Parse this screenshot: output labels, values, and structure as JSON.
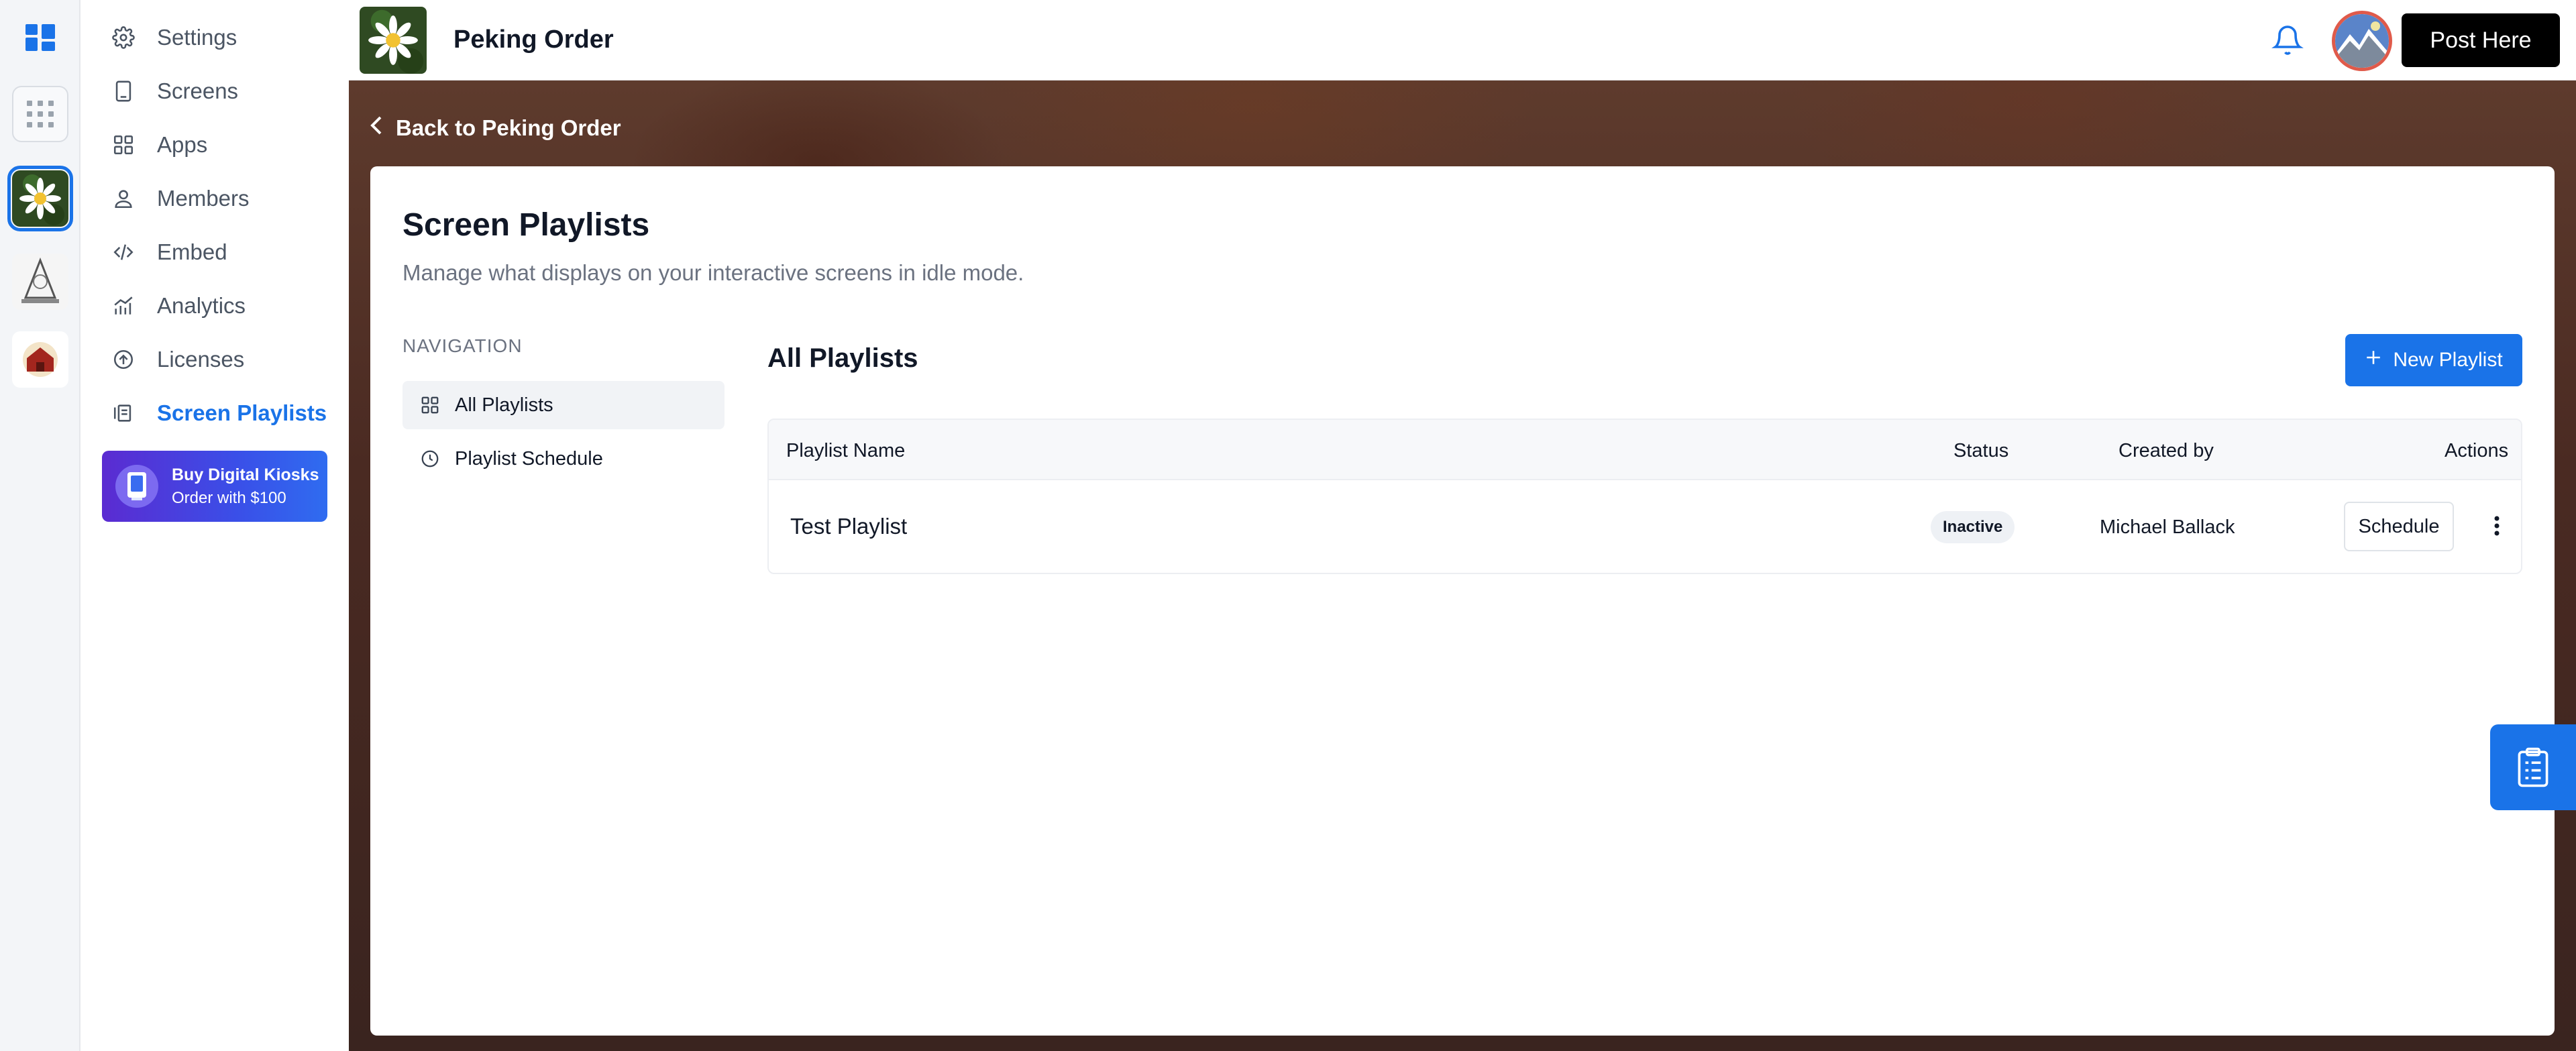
{
  "sidebar": {
    "items": [
      {
        "label": "Settings",
        "icon": "gear-icon"
      },
      {
        "label": "Screens",
        "icon": "tablet-icon"
      },
      {
        "label": "Apps",
        "icon": "grid-icon"
      },
      {
        "label": "Members",
        "icon": "user-icon"
      },
      {
        "label": "Embed",
        "icon": "code-icon"
      },
      {
        "label": "Analytics",
        "icon": "chart-icon"
      },
      {
        "label": "Licenses",
        "icon": "upload-circle-icon"
      },
      {
        "label": "Screen Playlists",
        "icon": "playlist-icon",
        "active": true
      }
    ],
    "promo": {
      "title": "Buy Digital Kiosks",
      "subtitle": "Order with $100"
    }
  },
  "topbar": {
    "store_name": "Peking Order",
    "post_button": "Post Here"
  },
  "back_link": "Back to Peking Order",
  "page": {
    "title": "Screen Playlists",
    "subtitle": "Manage what displays on your interactive screens in idle mode."
  },
  "inner_nav": {
    "heading": "NAVIGATION",
    "items": [
      {
        "label": "All Playlists",
        "active": true
      },
      {
        "label": "Playlist Schedule",
        "active": false
      }
    ]
  },
  "playlists": {
    "title": "All Playlists",
    "new_button": "New Playlist",
    "columns": [
      "Playlist Name",
      "Status",
      "Created by",
      "Actions"
    ],
    "rows": [
      {
        "name": "Test Playlist",
        "status": "Inactive",
        "created_by": "Michael Ballack",
        "action": "Schedule"
      }
    ]
  },
  "colors": {
    "accent": "#1a73e8",
    "promo_start": "#5b2bd1",
    "promo_end": "#2f6cf0"
  }
}
